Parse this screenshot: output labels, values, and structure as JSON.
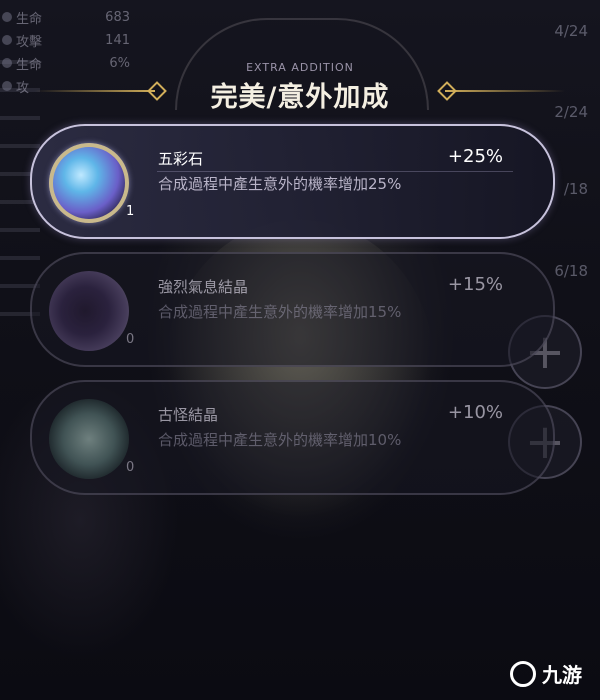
{
  "header": {
    "subtitle": "EXTRA ADDITION",
    "title": "完美/意外加成"
  },
  "stats": [
    {
      "label": "生命",
      "value": "683"
    },
    {
      "label": "攻擊",
      "value": "141"
    },
    {
      "label": "生命",
      "value": "6%"
    },
    {
      "label": "攻",
      "value": ""
    }
  ],
  "counters": [
    "4/24",
    "2/24",
    "/18",
    "6/18"
  ],
  "items": [
    {
      "name": "五彩石",
      "bonus": "+25%",
      "description": "合成過程中產生意外的機率增加25%",
      "count": "1",
      "active": true
    },
    {
      "name": "強烈氣息結晶",
      "bonus": "+15%",
      "description": "合成過程中產生意外的機率增加15%",
      "count": "0",
      "active": false
    },
    {
      "name": "古怪結晶",
      "bonus": "+10%",
      "description": "合成過程中產生意外的機率增加10%",
      "count": "0",
      "active": false
    }
  ],
  "side_buttons": [
    "+",
    "+"
  ],
  "watermark": {
    "text": "九游"
  },
  "colors": {
    "accent_gold": "#d2af5a",
    "card_border_active": "#c7c2dc"
  }
}
